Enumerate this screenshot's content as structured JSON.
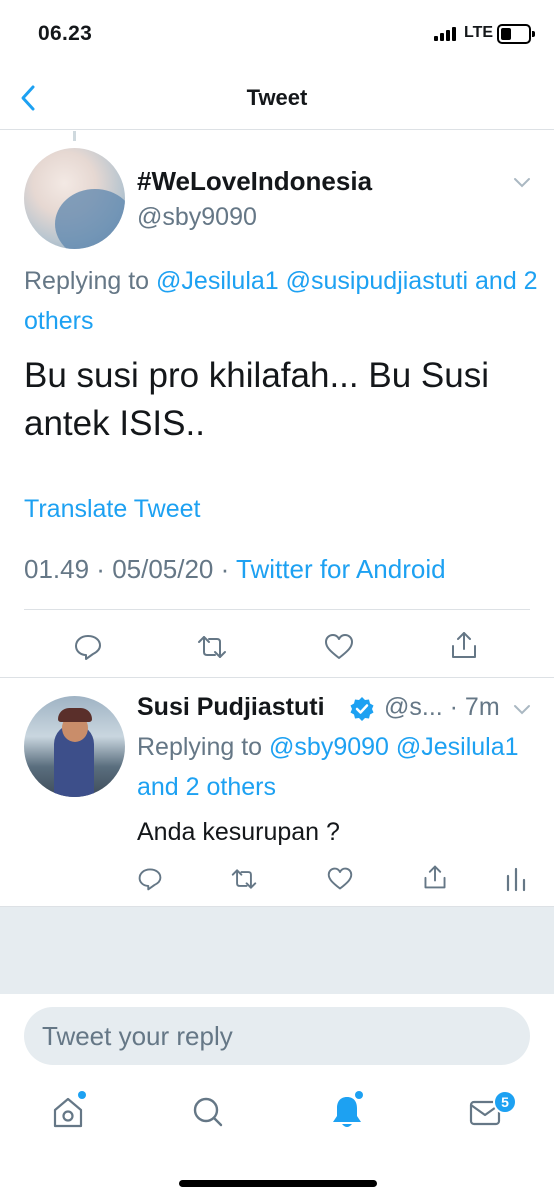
{
  "status_bar": {
    "time": "06.23",
    "network": "LTE"
  },
  "nav": {
    "title": "Tweet"
  },
  "main_tweet": {
    "display_name": "#WeLoveIndonesia",
    "handle": "@sby9090",
    "replying_prefix": "Replying to ",
    "mention_1": "@Jesilula1",
    "mention_2": "@susipudjiastuti",
    "others": "and 2 others",
    "text": "Bu susi pro khilafah... Bu Susi antek ISIS..",
    "translate": "Translate Tweet",
    "time": "01.49",
    "sep_1": " · ",
    "date": "05/05/20",
    "sep_2": " · ",
    "source": "Twitter for Android"
  },
  "reply_tweet": {
    "display_name": "Susi Pudjiastuti",
    "handle_time": "@s... · 7m",
    "replying_prefix": "Replying to ",
    "mention_1": "@sby9090",
    "mention_2": "@Jesilula1",
    "others": "and 2 others",
    "text": "Anda kesurupan ?"
  },
  "compose": {
    "placeholder": "Tweet your reply"
  },
  "tabbar": {
    "messages_badge": "5"
  },
  "colors": {
    "accent": "#1da1f2",
    "secondary_text": "#657786",
    "divider": "#dde1e5",
    "background_gray": "#e6ecf0"
  },
  "icons": {
    "actions": [
      "reply-icon",
      "retweet-icon",
      "like-icon",
      "share-icon",
      "analytics-icon"
    ],
    "tabs": [
      "home-icon",
      "search-icon",
      "notifications-icon",
      "messages-icon"
    ]
  }
}
